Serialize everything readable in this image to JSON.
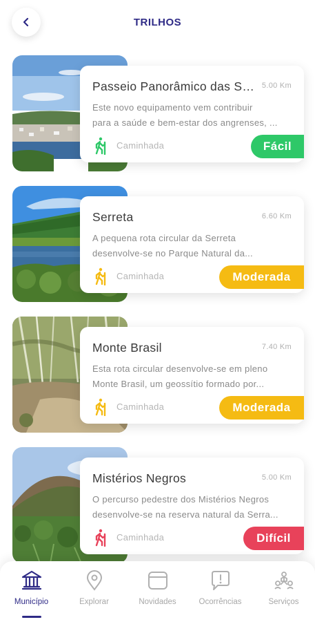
{
  "header": {
    "title": "TRILHOS",
    "back_icon": "chevron-left-icon"
  },
  "colors": {
    "primary": "#2e2a86",
    "easy": "#2ec868",
    "moderate": "#f5bb13",
    "hard": "#e8425a"
  },
  "trails": [
    {
      "name": "Passeio Panorâmico das Serras",
      "distance": "5.00 Km",
      "desc_line1": "Este novo equipamento vem contribuir",
      "desc_line2": "para a saúde e bem-estar dos angrenses, ...",
      "type": "Caminhada",
      "difficulty": "Fácil",
      "icon": "hiker-icon"
    },
    {
      "name": "Serreta",
      "distance": "6.60 Km",
      "desc_line1": "A pequena rota circular da Serreta",
      "desc_line2": "desenvolve-se no Parque Natural da...",
      "type": "Caminhada",
      "difficulty": "Moderada",
      "icon": "hiker-icon"
    },
    {
      "name": "Monte Brasil",
      "distance": "7.40 Km",
      "desc_line1": "Esta rota circular desenvolve-se em pleno",
      "desc_line2": "Monte Brasil, um geossítio formado por...",
      "type": "Caminhada",
      "difficulty": "Moderada",
      "icon": "hiker-icon"
    },
    {
      "name": "Mistérios Negros",
      "distance": "5.00 Km",
      "desc_line1": "O percurso pedestre dos Mistérios Negros",
      "desc_line2": "desenvolve-se na reserva natural da Serra...",
      "type": "Caminhada",
      "difficulty": "Difícil",
      "icon": "hiker-icon"
    }
  ],
  "nav": [
    {
      "label": "Município",
      "icon": "town-hall-icon",
      "active": true
    },
    {
      "label": "Explorar",
      "icon": "map-pin-icon",
      "active": false
    },
    {
      "label": "Novidades",
      "icon": "news-card-icon",
      "active": false
    },
    {
      "label": "Ocorrências",
      "icon": "alert-bubble-icon",
      "active": false
    },
    {
      "label": "Serviços",
      "icon": "services-icon",
      "active": false
    }
  ]
}
